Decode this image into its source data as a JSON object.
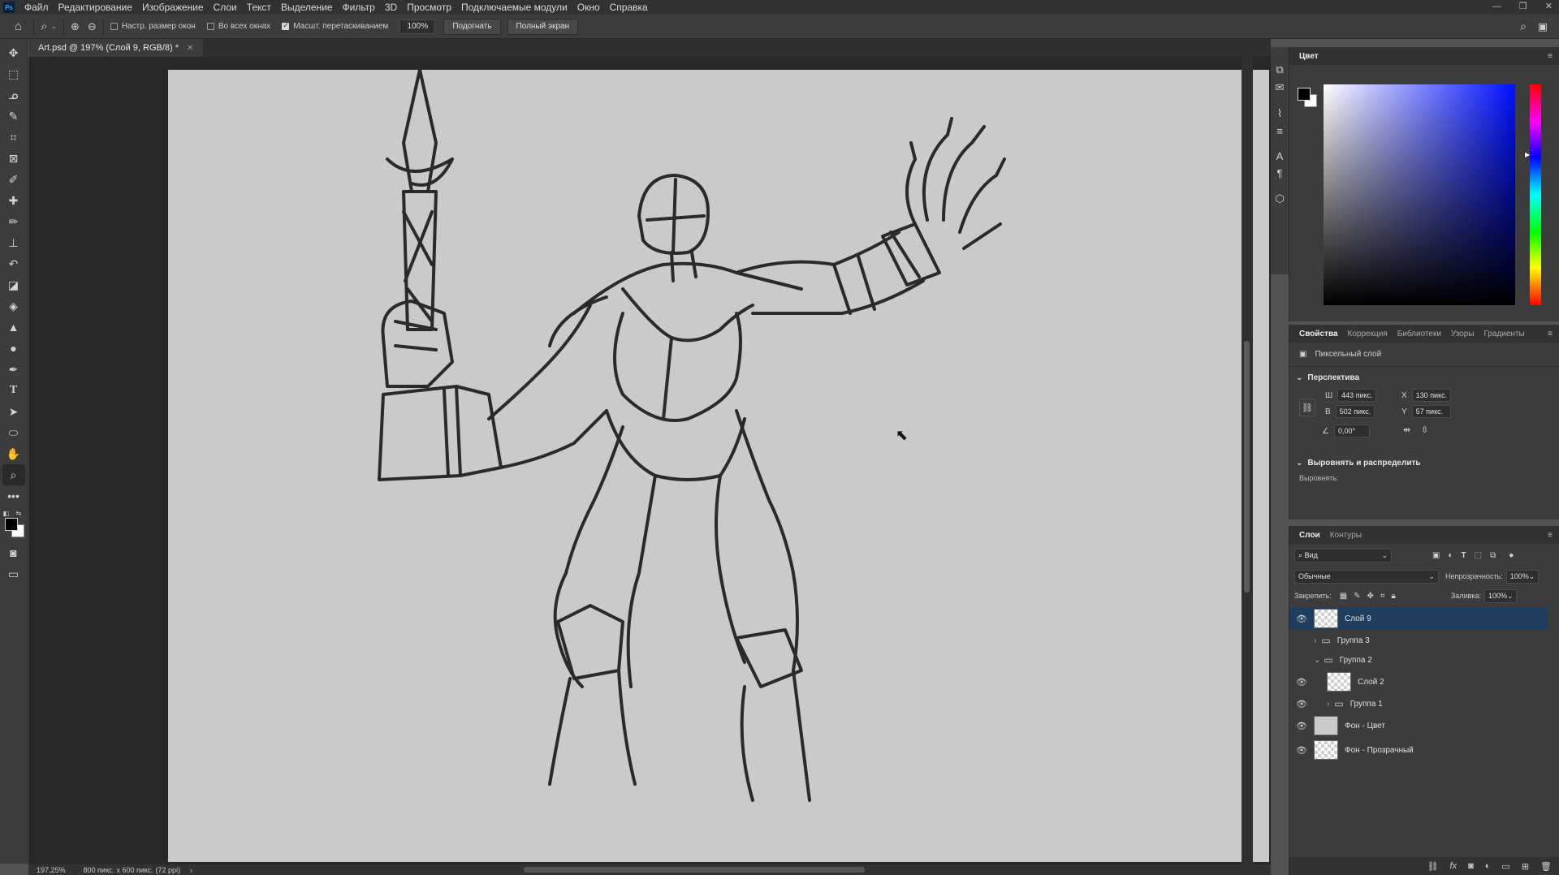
{
  "menubar": {
    "items": [
      "Файл",
      "Редактирование",
      "Изображение",
      "Слои",
      "Текст",
      "Выделение",
      "Фильтр",
      "3D",
      "Просмотр",
      "Подключаемые модули",
      "Окно",
      "Справка"
    ]
  },
  "options_bar": {
    "check_resize": "Настр. размер окон",
    "check_all_windows": "Во всех окнах",
    "check_scrubby": "Масшт. перетаскиванием",
    "zoom_value": "100%",
    "fit_button": "Подогнать",
    "fullscreen_button": "Полный экран"
  },
  "document": {
    "tab_title": "Art.psd @ 197% (Слой 9, RGB/8) *"
  },
  "status": {
    "zoom": "197,25%",
    "doc_info": "800 пикс. x 600 пикс. (72 ppi)"
  },
  "color_panel": {
    "title": "Цвет"
  },
  "properties_panel": {
    "tabs": [
      "Свойства",
      "Коррекция",
      "Библиотеки",
      "Узоры",
      "Градиенты"
    ],
    "layer_type": "Пиксельный слой",
    "perspective_title": "Перспектива",
    "w_label": "Ш",
    "w_value": "443 пикс.",
    "h_label": "В",
    "h_value": "502 пикс.",
    "x_label": "X",
    "x_value": "130 пикс.",
    "y_label": "Y",
    "y_value": "57 пикс.",
    "angle_value": "0,00°",
    "align_title": "Выровнять и распределить",
    "align_label": "Выровнять:"
  },
  "layers_panel": {
    "tabs": [
      "Слои",
      "Контуры"
    ],
    "filter_label": "Вид",
    "blend_mode": "Обычные",
    "opacity_label": "Непрозрачность:",
    "opacity_value": "100%",
    "lock_label": "Закрепить:",
    "fill_label": "Заливка:",
    "fill_value": "100%",
    "layers": [
      {
        "name": "Слой 9"
      },
      {
        "name": "Группа 3"
      },
      {
        "name": "Группа 2"
      },
      {
        "name": "Слой 2"
      },
      {
        "name": "Группа 1"
      },
      {
        "name": "Фон - Цвет"
      },
      {
        "name": "Фон - Прозрачный"
      }
    ]
  }
}
